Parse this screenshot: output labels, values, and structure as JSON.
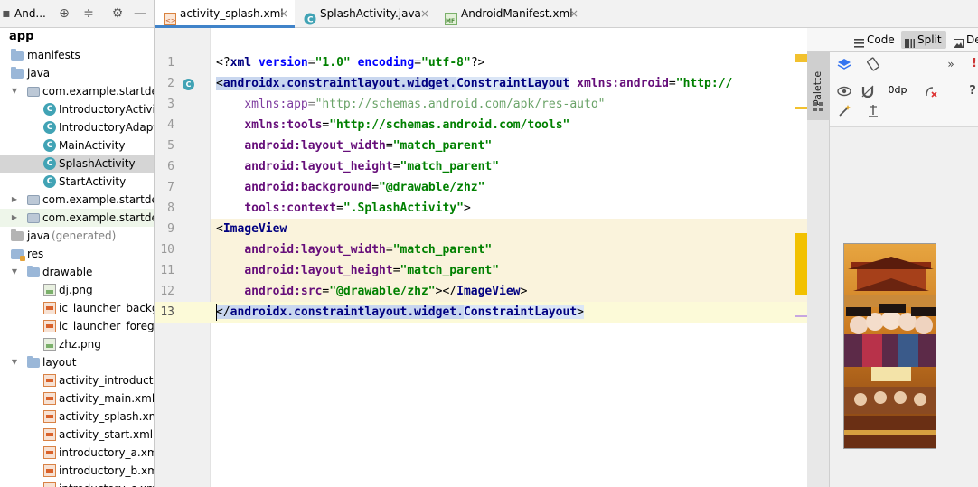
{
  "project_panel": {
    "title": "And...",
    "tree": [
      {
        "label": "app",
        "icon": "module-icon",
        "depth": 0,
        "expanded": true,
        "bold": true
      },
      {
        "label": "manifests",
        "icon": "folder-icon",
        "depth": 1,
        "expanded": false
      },
      {
        "label": "java",
        "icon": "folder-icon",
        "depth": 1,
        "expanded": true
      },
      {
        "label": "com.example.startdem",
        "icon": "package-icon",
        "depth": 2,
        "expanded": true
      },
      {
        "label": "IntroductoryActivity",
        "icon": "class-icon",
        "depth": 3
      },
      {
        "label": "IntroductoryAdapter",
        "icon": "class-icon",
        "depth": 3
      },
      {
        "label": "MainActivity",
        "icon": "class-icon",
        "depth": 3
      },
      {
        "label": "SplashActivity",
        "icon": "class-icon",
        "depth": 3,
        "selected": true
      },
      {
        "label": "StartActivity",
        "icon": "class-icon",
        "depth": 3
      },
      {
        "label": "com.example.startdem",
        "icon": "package-icon",
        "depth": 2,
        "expanded": false
      },
      {
        "label": "com.example.startdem",
        "icon": "package-icon",
        "depth": 2,
        "expanded": false,
        "vcs": true
      },
      {
        "label": "java",
        "suffix": " (generated)",
        "icon": "generated-folder-icon",
        "depth": 1,
        "expanded": false
      },
      {
        "label": "res",
        "icon": "res-folder-icon",
        "depth": 1,
        "expanded": true
      },
      {
        "label": "drawable",
        "icon": "folder-icon",
        "depth": 2,
        "expanded": true
      },
      {
        "label": "dj.png",
        "icon": "image-file-icon",
        "depth": 3
      },
      {
        "label": "ic_launcher_backgr",
        "icon": "xml-file-icon",
        "depth": 3
      },
      {
        "label": "ic_launcher_foregr",
        "icon": "xml-file-icon",
        "depth": 3
      },
      {
        "label": "zhz.png",
        "icon": "image-file-icon",
        "depth": 3
      },
      {
        "label": "layout",
        "icon": "folder-icon",
        "depth": 2,
        "expanded": true
      },
      {
        "label": "activity_introducto",
        "icon": "xml-file-icon",
        "depth": 3
      },
      {
        "label": "activity_main.xml",
        "icon": "xml-file-icon",
        "depth": 3
      },
      {
        "label": "activity_splash.xml",
        "icon": "xml-file-icon",
        "depth": 3
      },
      {
        "label": "activity_start.xml",
        "icon": "xml-file-icon",
        "depth": 3
      },
      {
        "label": "introductory_a.xml",
        "icon": "xml-file-icon",
        "depth": 3
      },
      {
        "label": "introductory_b.xml",
        "icon": "xml-file-icon",
        "depth": 3
      },
      {
        "label": "introductory_c.xml",
        "icon": "xml-file-icon",
        "depth": 3
      }
    ]
  },
  "tabs": [
    {
      "label": "activity_splash.xml",
      "icon": "xml-file-icon",
      "active": true,
      "close": "×"
    },
    {
      "label": "SplashActivity.java",
      "icon": "class-icon",
      "active": false,
      "close": "×"
    },
    {
      "label": "AndroidManifest.xml",
      "icon": "manifest-icon",
      "active": false,
      "close": "×"
    }
  ],
  "editor": {
    "line_numbers": [
      "1",
      "2",
      "3",
      "4",
      "5",
      "6",
      "7",
      "8",
      "9",
      "10",
      "11",
      "12",
      "13"
    ],
    "current_line": 13,
    "gutter_class_marker": "C",
    "lines": [
      [
        [
          "punct",
          "<?"
        ],
        [
          "tag",
          "xml "
        ],
        [
          "attr",
          "version"
        ],
        [
          "punct",
          "="
        ],
        [
          "str",
          "\"1.0\" "
        ],
        [
          "attr",
          "encoding"
        ],
        [
          "punct",
          "="
        ],
        [
          "str",
          "\"utf-8\""
        ],
        [
          "punct",
          "?>"
        ]
      ],
      [
        [
          "sel",
          "<"
        ],
        [
          "sel-tag",
          "androidx.constraintlayout.widget."
        ],
        [
          "sel2-tag",
          "ConstraintLayout"
        ],
        [
          "punct",
          " "
        ],
        [
          "attrp",
          "xmlns:android"
        ],
        [
          "punct",
          "="
        ],
        [
          "str",
          "\"http://"
        ]
      ],
      [
        [
          "punct",
          "    "
        ],
        [
          "ns-dim",
          "xmlns:app"
        ],
        [
          "dim",
          "="
        ],
        [
          "str-dim",
          "\"http://schemas.android.com/apk/res-auto\""
        ]
      ],
      [
        [
          "punct",
          "    "
        ],
        [
          "attrp",
          "xmlns:tools"
        ],
        [
          "punct",
          "="
        ],
        [
          "str",
          "\"http://schemas.android.com/tools\""
        ]
      ],
      [
        [
          "punct",
          "    "
        ],
        [
          "attrp",
          "android:layout_width"
        ],
        [
          "punct",
          "="
        ],
        [
          "str",
          "\"match_parent\""
        ]
      ],
      [
        [
          "punct",
          "    "
        ],
        [
          "attrp",
          "android:layout_height"
        ],
        [
          "punct",
          "="
        ],
        [
          "str",
          "\"match_parent\""
        ]
      ],
      [
        [
          "punct",
          "    "
        ],
        [
          "attrp",
          "android:background"
        ],
        [
          "punct",
          "="
        ],
        [
          "str",
          "\"@drawable/zhz\""
        ]
      ],
      [
        [
          "punct",
          "    "
        ],
        [
          "attrp",
          "tools:context"
        ],
        [
          "punct",
          "="
        ],
        [
          "str",
          "\".SplashActivity\""
        ],
        [
          "punct",
          ">"
        ]
      ],
      [
        [
          "punct",
          "<"
        ],
        [
          "tag",
          "ImageView"
        ]
      ],
      [
        [
          "punct",
          "    "
        ],
        [
          "attrp",
          "android:layout_width"
        ],
        [
          "punct",
          "="
        ],
        [
          "str",
          "\"match_parent\""
        ]
      ],
      [
        [
          "punct",
          "    "
        ],
        [
          "attrp",
          "android:layout_height"
        ],
        [
          "punct",
          "="
        ],
        [
          "str",
          "\"match_parent\""
        ]
      ],
      [
        [
          "punct",
          "    "
        ],
        [
          "attrp",
          "android:src"
        ],
        [
          "punct",
          "="
        ],
        [
          "str",
          "\"@drawable/zhz\""
        ],
        [
          "punct",
          "></"
        ],
        [
          "tag",
          "ImageView"
        ],
        [
          "punct",
          ">"
        ]
      ],
      [
        [
          "sel",
          "</"
        ],
        [
          "sel-tag",
          "androidx.constraintlayout.widget."
        ],
        [
          "sel2-tag",
          "ConstraintLayout"
        ],
        [
          "sel2",
          ">"
        ]
      ]
    ]
  },
  "modes": {
    "code_label": "Code",
    "split_label": "Split",
    "design_label": "De"
  },
  "palette": {
    "label": "Palette"
  },
  "design_toolbar": {
    "margin_value": "0dp"
  },
  "colors": {
    "accent": "#4083c9",
    "selection": "#c9d7ef",
    "current_line": "#fcfad8",
    "highlight_block": "#faf3dc",
    "string_green": "#008000",
    "attr_purple": "#660e7a",
    "tag_navy": "#000080"
  }
}
